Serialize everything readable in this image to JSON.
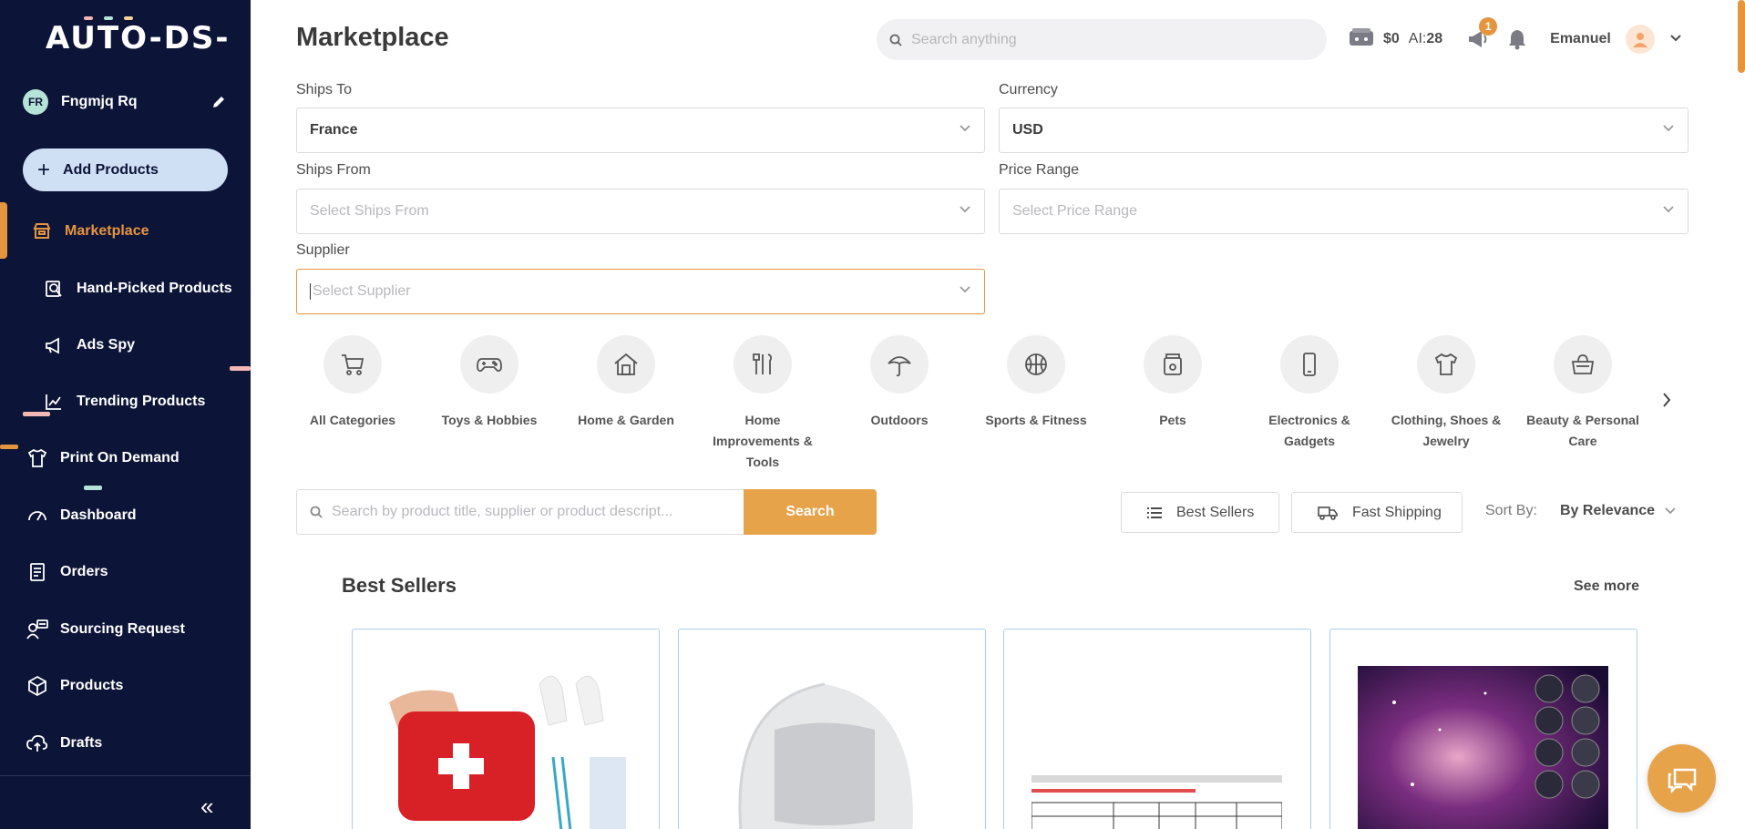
{
  "sidebar": {
    "logo": "AUTO-DS-",
    "account": {
      "initials": "FR",
      "name": "Fngmjq Rq"
    },
    "add_products": "Add Products",
    "items": [
      {
        "label": "Marketplace",
        "icon": "store-icon",
        "active": true
      },
      {
        "label": "Hand-Picked Products",
        "icon": "search-product-icon"
      },
      {
        "label": "Ads Spy",
        "icon": "megaphone-icon"
      },
      {
        "label": "Trending Products",
        "icon": "trend-chart-icon"
      },
      {
        "label": "Print On Demand",
        "icon": "tshirt-icon"
      },
      {
        "label": "Dashboard",
        "icon": "gauge-icon"
      },
      {
        "label": "Orders",
        "icon": "clipboard-icon"
      },
      {
        "label": "Sourcing Request",
        "icon": "sourcing-icon"
      },
      {
        "label": "Products",
        "icon": "box-icon"
      },
      {
        "label": "Drafts",
        "icon": "cloud-upload-icon"
      }
    ],
    "collapse_glyph": "«"
  },
  "header": {
    "title": "Marketplace",
    "search_placeholder": "Search anything",
    "balance": "$0",
    "ai_label": "AI:",
    "ai_value": "28",
    "notification_count": "1",
    "username": "Emanuel"
  },
  "filters": {
    "ships_to": {
      "label": "Ships To",
      "value": "France"
    },
    "currency": {
      "label": "Currency",
      "value": "USD"
    },
    "ships_from": {
      "label": "Ships From",
      "placeholder": "Select Ships From"
    },
    "price_range": {
      "label": "Price Range",
      "placeholder": "Select Price Range"
    },
    "supplier": {
      "label": "Supplier",
      "placeholder": "Select Supplier"
    }
  },
  "categories": [
    {
      "label": "All Categories",
      "icon": "cart-icon"
    },
    {
      "label": "Toys & Hobbies",
      "icon": "gamepad-icon"
    },
    {
      "label": "Home & Garden",
      "icon": "house-icon"
    },
    {
      "label": "Home Improvements & Tools",
      "icon": "tools-icon"
    },
    {
      "label": "Outdoors",
      "icon": "umbrella-icon"
    },
    {
      "label": "Sports & Fitness",
      "icon": "basketball-icon"
    },
    {
      "label": "Pets",
      "icon": "pet-food-icon"
    },
    {
      "label": "Electronics & Gadgets",
      "icon": "phone-icon"
    },
    {
      "label": "Clothing, Shoes & Jewelry",
      "icon": "shirt-icon"
    },
    {
      "label": "Beauty & Personal Care",
      "icon": "cosmetic-bag-icon"
    }
  ],
  "product_search": {
    "placeholder": "Search by product title, supplier or product descript...",
    "button": "Search",
    "best_sellers": "Best Sellers",
    "fast_shipping": "Fast Shipping",
    "sort_label": "Sort By:",
    "sort_value": "By Relevance"
  },
  "best_sellers_section": {
    "title": "Best Sellers",
    "see_more": "See more",
    "cards": [
      {
        "name": "first-aid-kit"
      },
      {
        "name": "balaclava-cap"
      },
      {
        "name": "size-chart-garment"
      },
      {
        "name": "galaxy-print"
      }
    ]
  },
  "colors": {
    "sidebar_bg": "#0c1437",
    "accent": "#e6953f",
    "add_button_bg": "#cfe0f5",
    "card_border": "#a9cdee"
  }
}
